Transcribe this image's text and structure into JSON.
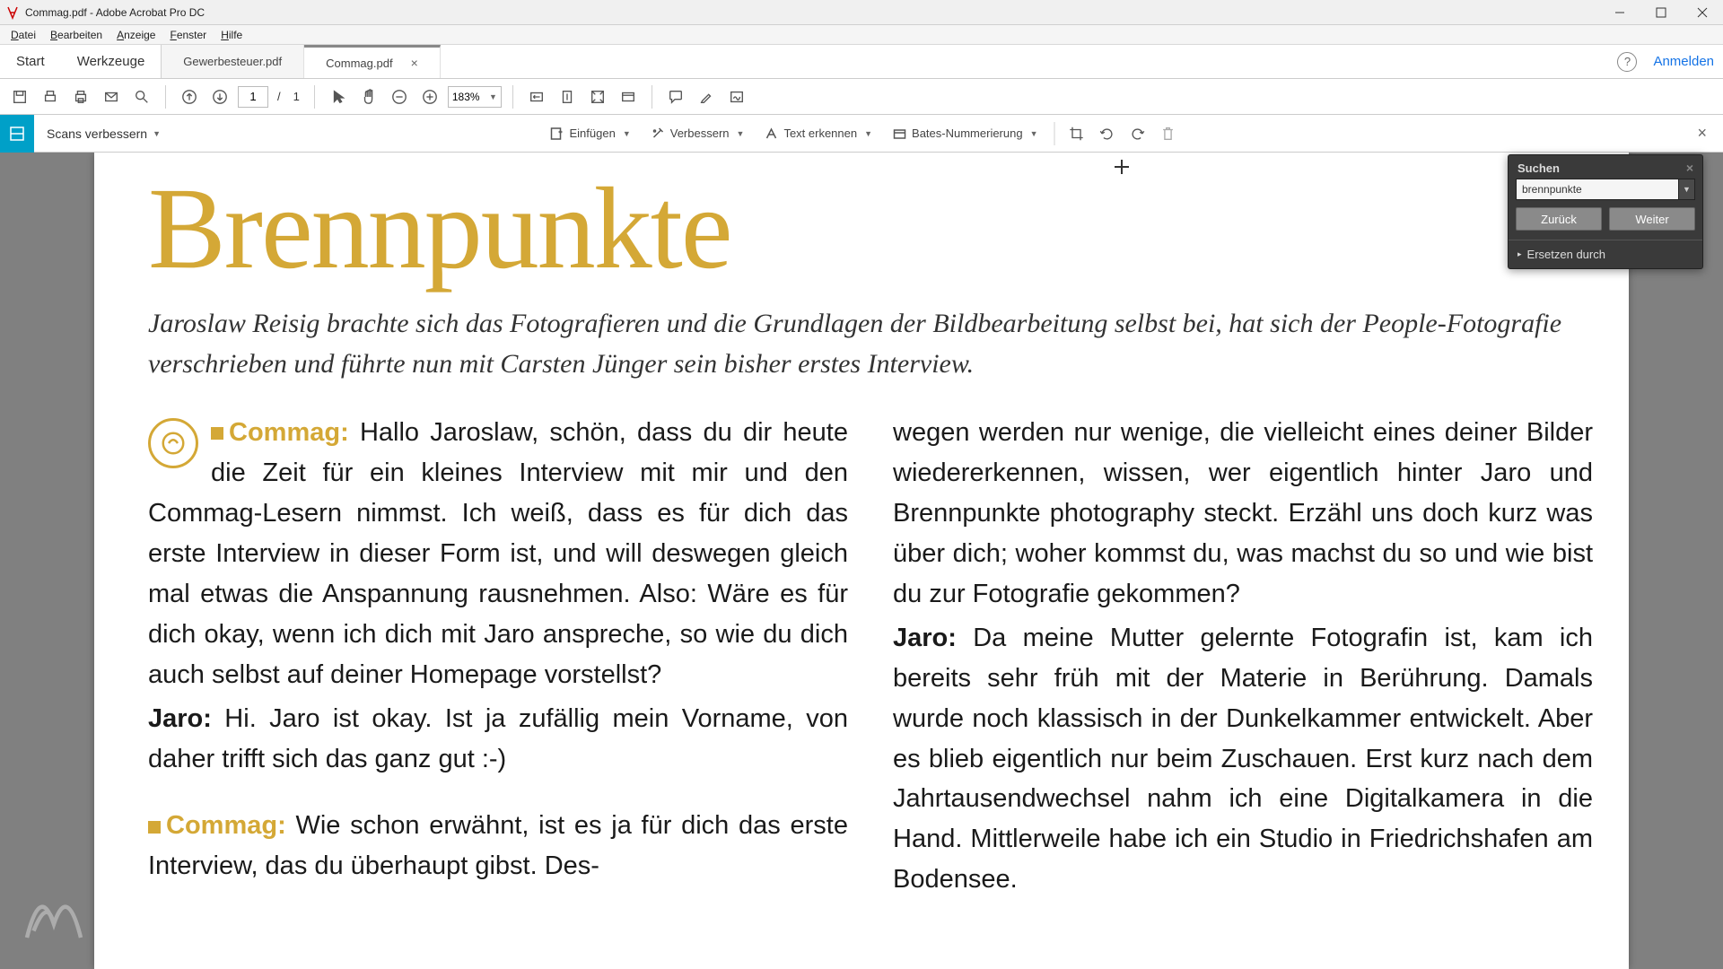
{
  "window": {
    "title": "Commag.pdf - Adobe Acrobat Pro DC"
  },
  "menu": {
    "file": "Datei",
    "edit": "Bearbeiten",
    "view": "Anzeige",
    "window": "Fenster",
    "help": "Hilfe"
  },
  "tabs": {
    "start": "Start",
    "tools": "Werkzeuge",
    "doc1": "Gewerbesteuer.pdf",
    "doc2": "Commag.pdf",
    "help_tip": "?",
    "login": "Anmelden"
  },
  "toolbar": {
    "page_current": "1",
    "page_sep": "/",
    "page_total": "1",
    "zoom": "183%"
  },
  "scanbar": {
    "title": "Scans verbessern",
    "insert": "Einfügen",
    "enhance": "Verbessern",
    "ocr": "Text erkennen",
    "bates": "Bates-Nummerierung"
  },
  "search": {
    "title": "Suchen",
    "value": "brennpunkte",
    "prev": "Zurück",
    "next": "Weiter",
    "replace": "Ersetzen durch"
  },
  "document": {
    "heading": "Brennpunkte",
    "intro": "Jaroslaw Reisig brachte sich das Fotografieren und die Grundlagen der Bildbearbeitung selbst bei, hat sich der People-Fotografie verschrieben und führte nun mit Carsten Jünger sein bisher erstes Interview.",
    "col1": {
      "p1_tag": "Commag:",
      "p1": " Hallo Jaroslaw, schön, dass du dir heute die Zeit für ein kleines Interview mit mir und den Commag-Lesern nimmst. Ich weiß, dass es für dich das erste Interview in dieser Form ist, und will deswegen gleich mal etwas die An­spannung rausnehmen. Also: Wäre es für dich okay, wenn ich dich mit Jaro anspreche, so wie du dich auch selbst auf deiner Homepage vorstellst?",
      "p2_speaker": "Jaro:",
      "p2": " Hi. Jaro ist okay. Ist ja zufällig mein Vorname, von daher trifft sich das ganz gut :-)",
      "p3_tag": "Commag:",
      "p3": " Wie schon erwähnt, ist es ja für dich das erste Interview, das du überhaupt gibst. Des-"
    },
    "col2": {
      "p1": "wegen werden nur wenige, die vielleicht eines dei­ner Bilder wiedererkennen, wissen, wer eigentlich hinter Jaro und Brennpunkte photography steckt. Erzähl uns doch kurz was über dich; woher kommst du, was machst du so und wie bist du zur Fotografie gekommen?",
      "p2_speaker": "Jaro:",
      "p2": " Da meine Mutter gelernte Fotografin ist, kam ich bereits sehr früh mit der Materie in Berührung. Da­mals wurde noch klassisch in der Dunkelkammer ent­wickelt. Aber es blieb eigentlich nur beim Zuschauen. Erst kurz nach dem Jahrtausendwechsel nahm ich eine Digitalkamera in die Hand. Mittlerweile habe ich ein Studio in Friedrichshafen am Bodensee."
    }
  }
}
